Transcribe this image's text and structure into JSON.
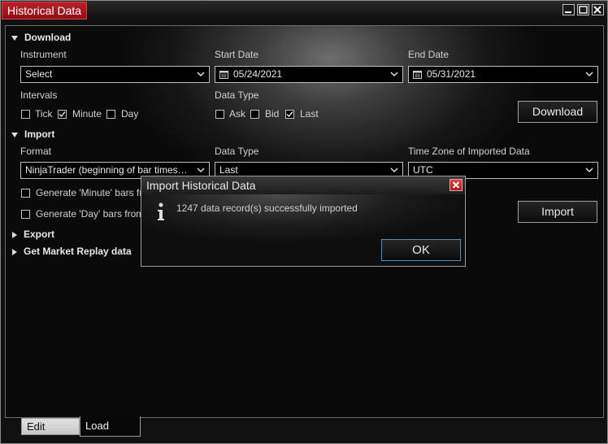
{
  "window": {
    "title": "Historical Data",
    "controls": {
      "minimize": "minimize-icon",
      "maximize": "maximize-icon",
      "close": "close-icon"
    }
  },
  "download": {
    "header": "Download",
    "instrument_label": "Instrument",
    "instrument_value": "Select",
    "start_date_label": "Start Date",
    "start_date_value": "05/24/2021",
    "end_date_label": "End Date",
    "end_date_value": "05/31/2021",
    "intervals_label": "Intervals",
    "intervals": [
      {
        "label": "Tick",
        "checked": false
      },
      {
        "label": "Minute",
        "checked": true
      },
      {
        "label": "Day",
        "checked": false
      }
    ],
    "data_type_label": "Data Type",
    "data_types": [
      {
        "label": "Ask",
        "checked": false
      },
      {
        "label": "Bid",
        "checked": false
      },
      {
        "label": "Last",
        "checked": true
      }
    ],
    "button_label": "Download"
  },
  "import": {
    "header": "Import",
    "format_label": "Format",
    "format_value": "NinjaTrader (beginning of bar times…",
    "data_type_label": "Data Type",
    "data_type_value": "Last",
    "timezone_label": "Time Zone of Imported Data",
    "timezone_value": "UTC",
    "generate_minute_label": "Generate 'Minute' bars fr",
    "generate_day_label": "Generate 'Day' bars from",
    "button_label": "Import"
  },
  "export": {
    "header": "Export"
  },
  "market_replay": {
    "header": "Get Market Replay data"
  },
  "dialog": {
    "title": "Import Historical Data",
    "message": "1247 data record(s) successfully imported",
    "ok_label": "OK",
    "icon": "info-icon"
  },
  "bottom_tabs": [
    {
      "label": "Edit",
      "active": false
    },
    {
      "label": "Load",
      "active": true
    }
  ],
  "colors": {
    "accent": "#a0161f",
    "focus_border": "#4a90c8"
  }
}
